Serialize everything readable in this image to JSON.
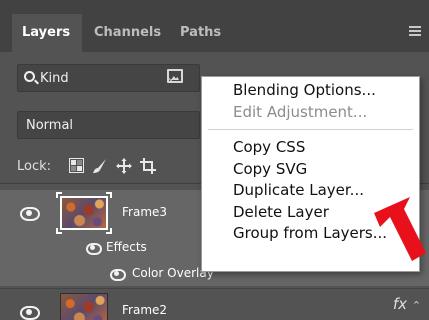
{
  "tabs": [
    {
      "label": "Layers",
      "active": true
    },
    {
      "label": "Channels",
      "active": false
    },
    {
      "label": "Paths",
      "active": false
    }
  ],
  "filter": {
    "kind_label": "Kind"
  },
  "blend": {
    "mode": "Normal"
  },
  "lock": {
    "label": "Lock:"
  },
  "layers": [
    {
      "name": "Frame3",
      "selected": true,
      "effects_label": "Effects",
      "color_overlay_label": "Color Overlay"
    },
    {
      "name": "Frame2",
      "fx_label": "fx"
    }
  ],
  "context_menu": {
    "items": [
      {
        "label": "Blending Options...",
        "enabled": true
      },
      {
        "label": "Edit Adjustment...",
        "enabled": false
      },
      {
        "label": "Copy CSS",
        "enabled": true
      },
      {
        "label": "Copy SVG",
        "enabled": true
      },
      {
        "label": "Duplicate Layer...",
        "enabled": true
      },
      {
        "label": "Delete Layer",
        "enabled": true
      },
      {
        "label": "Group from Layers...",
        "enabled": true
      }
    ]
  },
  "colors": {
    "panel_bg": "#535353",
    "tabbar_bg": "#424242",
    "selected_row": "#666666",
    "menu_bg": "#ffffff",
    "arrow": "#e8101a"
  },
  "icons": [
    "search-icon",
    "image-filter-icon",
    "lock-transparent-pixels-icon",
    "lock-image-pixels-icon",
    "lock-position-icon",
    "lock-artboard-icon",
    "eye-icon",
    "panel-menu-icon"
  ]
}
